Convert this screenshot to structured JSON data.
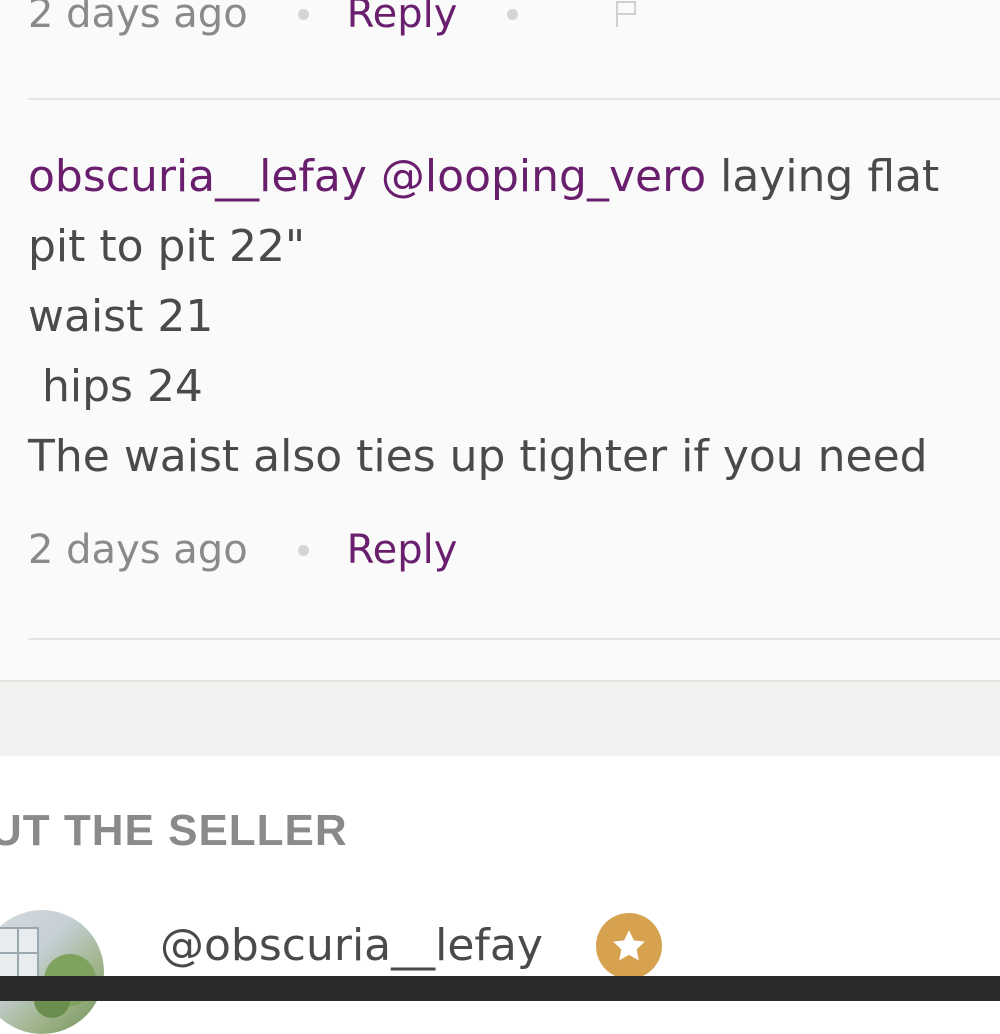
{
  "previous_comment": {
    "timestamp": "2 days ago",
    "reply_label": "Reply"
  },
  "comment": {
    "username": "obscuria__lefay",
    "mention": "@looping_vero",
    "first_line_text": " laying flat",
    "lines": [
      "pit to pit 22\"",
      "waist 21",
      " hips 24",
      "The waist also ties up tighter if you need"
    ],
    "timestamp": "2 days ago",
    "reply_label": "Reply"
  },
  "seller": {
    "section_title": "UT THE SELLER",
    "handle": "@obscuria__lefay",
    "badge_icon": "star-icon",
    "badge_color": "#d6a24f"
  },
  "colors": {
    "accent": "#6a1f6e",
    "text": "#4a4a4a",
    "muted": "#8a8a8a"
  }
}
